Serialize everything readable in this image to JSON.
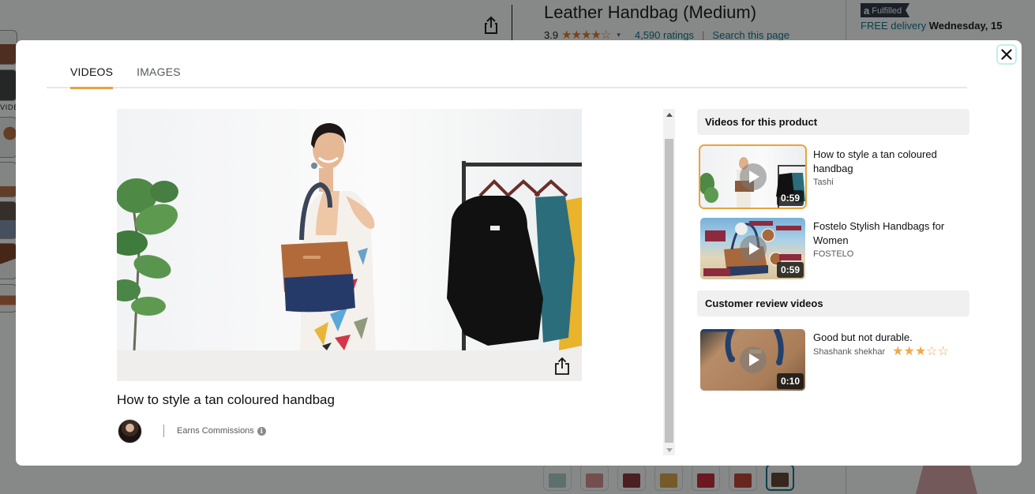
{
  "background_page": {
    "product_title": "Leather Handbag (Medium)",
    "rating_value": "3.9",
    "rating_stars": "★★★★☆",
    "ratings_count": "4,590 ratings",
    "search_link": "Search this page",
    "fulfilled_badge": "Fulfilled",
    "fulfilled_logo": "a",
    "free_delivery_label": "FREE delivery",
    "delivery_date": "Wednesday, 15",
    "left_thumbs_videos_label": "VIDEOS",
    "color_swatches": [
      {
        "color": "#a9cfc9"
      },
      {
        "color": "#d98c8c"
      },
      {
        "color": "#8b2a33"
      },
      {
        "color": "#d9a440"
      },
      {
        "color": "#c81f2e"
      },
      {
        "color": "#c03a2e"
      },
      {
        "color": "#5b3d2a",
        "selected": true
      }
    ]
  },
  "modal": {
    "tabs": [
      {
        "label": "VIDEOS",
        "active": true
      },
      {
        "label": "IMAGES",
        "active": false
      }
    ],
    "player": {
      "title": "How to style a tan coloured handbag",
      "earns_commissions": "Earns Commissions",
      "info_glyph": "i"
    },
    "sections": [
      {
        "header": "Videos for this product",
        "videos": [
          {
            "title": "How to style a tan coloured handbag",
            "author": "Tashi",
            "duration": "0:59",
            "selected": true
          },
          {
            "title": "Fostelo Stylish Handbags for Women",
            "author": "FOSTELO",
            "duration": "0:59",
            "selected": false
          }
        ]
      },
      {
        "header": "Customer review videos",
        "videos": [
          {
            "title": "Good but not durable.",
            "author": "Shashank shekhar",
            "duration": "0:10",
            "rating": 3,
            "rating_max": 5,
            "selected": false
          }
        ]
      }
    ]
  },
  "colors": {
    "accent_tab": "#e8a33c",
    "link": "#007185",
    "star": "#f3a847"
  }
}
